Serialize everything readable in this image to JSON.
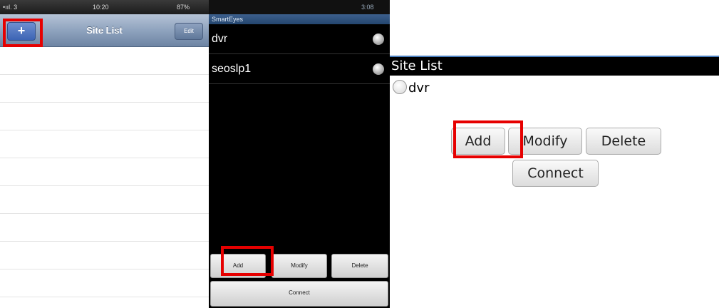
{
  "iphone": {
    "status": {
      "carrier": "•ııl. 3",
      "time": "10:20",
      "battery": "87%"
    },
    "nav": {
      "add_label": "+",
      "title": "Site List",
      "edit_label": "Edit"
    }
  },
  "android": {
    "status": {
      "time": "3:08"
    },
    "app_title": "SmartEyes",
    "sites": [
      "dvr",
      "seoslp1"
    ],
    "buttons": {
      "add": "Add",
      "modify": "Modify",
      "delete": "Delete",
      "connect": "Connect"
    }
  },
  "blackberry": {
    "title": "Site List",
    "sites": [
      "dvr"
    ],
    "buttons": {
      "add": "Add",
      "modify": "Modify",
      "delete": "Delete",
      "connect": "Connect"
    }
  },
  "colors": {
    "highlight": "#e60000",
    "ios_nav": "#8fa3be",
    "android_title": "#24466f"
  }
}
